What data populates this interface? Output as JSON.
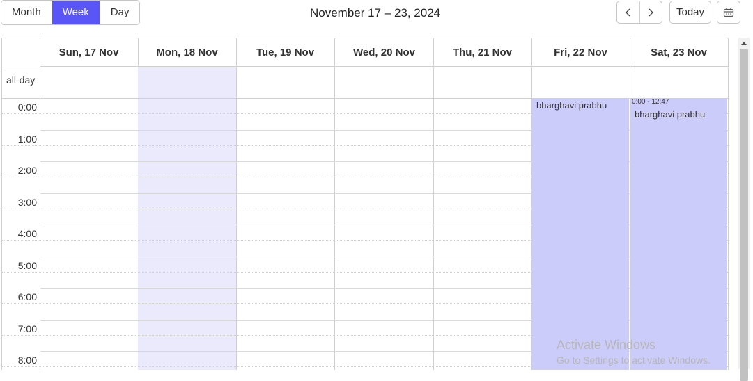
{
  "toolbar": {
    "views": [
      "Month",
      "Week",
      "Day"
    ],
    "active_view": "Week",
    "title": "November 17 – 23, 2024",
    "prev_icon": "chevron-left-icon",
    "next_icon": "chevron-right-icon",
    "today_label": "Today",
    "calendar_icon": "calendar-icon"
  },
  "calendar": {
    "days": [
      "Sun, 17 Nov",
      "Mon, 18 Nov",
      "Tue, 19 Nov",
      "Wed, 20 Nov",
      "Thu, 21 Nov",
      "Fri, 22 Nov",
      "Sat, 23 Nov"
    ],
    "today_index": 1,
    "allday_label": "all-day",
    "hours": [
      "0:00",
      "1:00",
      "2:00",
      "3:00",
      "4:00",
      "5:00",
      "6:00",
      "7:00",
      "8:00"
    ],
    "events": [
      {
        "title": "bharghavi prabhu",
        "time": "",
        "day_index": 5
      },
      {
        "title": "bharghavi prabhu",
        "time": "0:00 - 12:47",
        "day_index": 6
      }
    ],
    "colors": {
      "accent": "#5a55f7",
      "today_bg": "#ebeafd",
      "event_bg": "#ccccfb"
    }
  },
  "watermark": {
    "title": "Activate Windows",
    "subtitle": "Go to Settings to activate Windows."
  }
}
